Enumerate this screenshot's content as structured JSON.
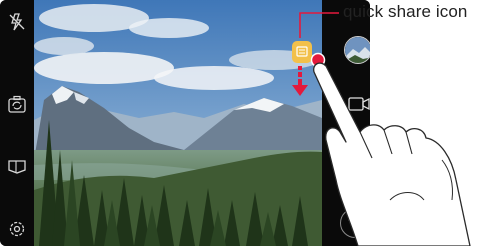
{
  "annotation": {
    "label": "quick share icon"
  },
  "icons": {
    "flash": "flash-off-icon",
    "switch_camera": "switch-camera-icon",
    "mode": "mode-icon",
    "settings": "gear-icon",
    "gallery": "gallery-thumbnail",
    "video": "video-record-icon",
    "back": "back-icon",
    "quick_share": "quick-share-icon"
  },
  "colors": {
    "accent": "#e4193c",
    "quick_share": "#f2c04a"
  }
}
